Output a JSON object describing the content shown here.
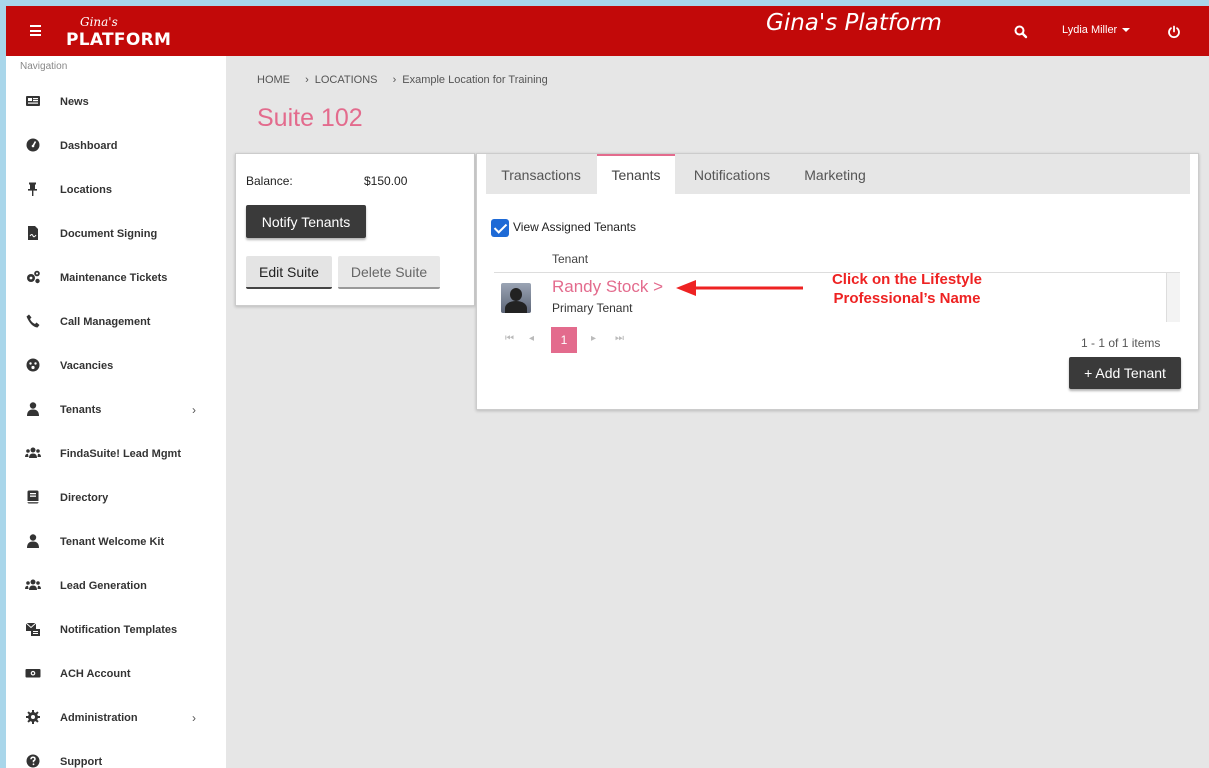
{
  "header": {
    "logo_script": "Gina's",
    "logo_word": "PLATFORM",
    "title": "Gina's Platform",
    "user_name": "Lydia Miller"
  },
  "sidebar": {
    "heading": "Navigation",
    "items": [
      {
        "label": "News",
        "icon": "newspaper-icon"
      },
      {
        "label": "Dashboard",
        "icon": "gauge-icon"
      },
      {
        "label": "Locations",
        "icon": "pin-icon"
      },
      {
        "label": "Document Signing",
        "icon": "document-icon"
      },
      {
        "label": "Maintenance Tickets",
        "icon": "cogs-icon"
      },
      {
        "label": "Call Management",
        "icon": "phone-icon"
      },
      {
        "label": "Vacancies",
        "icon": "smiley-icon"
      },
      {
        "label": "Tenants",
        "icon": "user-icon",
        "expandable": true
      },
      {
        "label": "FindaSuite! Lead Mgmt",
        "icon": "users-icon"
      },
      {
        "label": "Directory",
        "icon": "book-icon"
      },
      {
        "label": "Tenant Welcome Kit",
        "icon": "user-icon"
      },
      {
        "label": "Lead Generation",
        "icon": "users-icon"
      },
      {
        "label": "Notification Templates",
        "icon": "mail-template-icon"
      },
      {
        "label": "ACH Account",
        "icon": "money-icon"
      },
      {
        "label": "Administration",
        "icon": "gear-icon",
        "expandable": true
      },
      {
        "label": "Support",
        "icon": "question-icon"
      }
    ]
  },
  "breadcrumb": {
    "home": "HOME",
    "locations": "LOCATIONS",
    "current": "Example Location for Training"
  },
  "page_title": "Suite 102",
  "suite_card": {
    "balance_label": "Balance:",
    "balance_value": "$150.00",
    "notify_label": "Notify Tenants",
    "edit_label": "Edit Suite",
    "delete_label": "Delete Suite"
  },
  "tabs": [
    {
      "label": "Transactions",
      "active": false
    },
    {
      "label": "Tenants",
      "active": true
    },
    {
      "label": "Notifications",
      "active": false
    },
    {
      "label": "Marketing",
      "active": false
    }
  ],
  "tenants_panel": {
    "view_assigned_label": "View Assigned Tenants",
    "view_assigned_checked": true,
    "column_header": "Tenant",
    "rows": [
      {
        "name": "Randy Stock >",
        "role": "Primary Tenant"
      }
    ],
    "current_page": "1",
    "items_info": "1 - 1 of 1 items",
    "add_label": "+ Add Tenant"
  },
  "annotation": {
    "text_line1": "Click on the Lifestyle",
    "text_line2": "Professional’s Name",
    "color": "#ee2222"
  },
  "colors": {
    "header_red": "#c20909",
    "accent_pink": "#e36b8d",
    "dark_button": "#3a3a3a"
  }
}
